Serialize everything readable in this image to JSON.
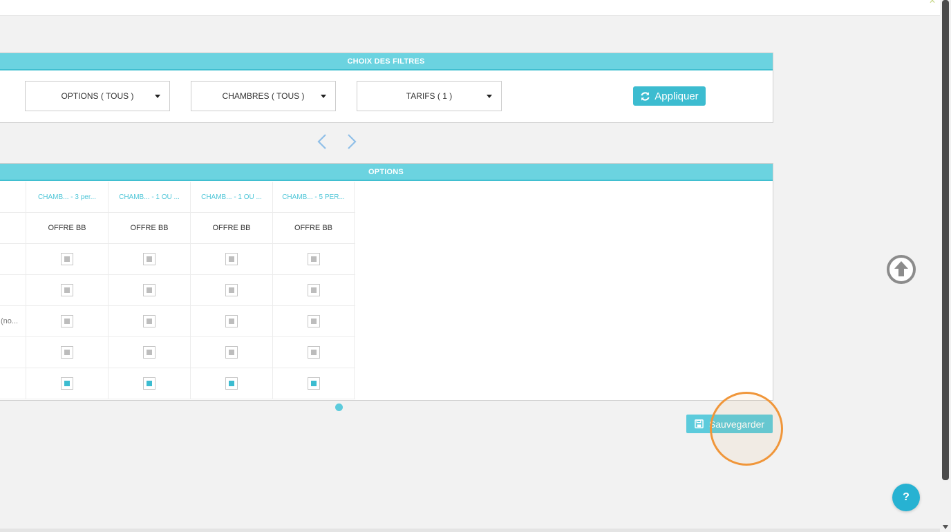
{
  "filters": {
    "title": "CHOIX DES FILTRES",
    "options_label": "OPTIONS ( TOUS )",
    "rooms_label": "CHAMBRES ( TOUS )",
    "rates_label": "TARIFS ( 1 )",
    "apply_label": "Appliquer"
  },
  "options": {
    "title": "OPTIONS",
    "columns": [
      "CHAMB... - 3 per...",
      "CHAMB... - 1 OU ...",
      "CHAMB... - 1 OU ...",
      "CHAMB... - 5 PER..."
    ],
    "offer": "OFFRE BB",
    "row_stub": "(no...",
    "checked_rows": [
      false,
      false,
      false,
      false,
      true
    ]
  },
  "actions": {
    "save_label": "Sauvegarder",
    "help_label": "?"
  },
  "colors": {
    "accent": "#6bd3e0",
    "button": "#3cbcd0",
    "highlight": "#f0963a"
  },
  "icons": {
    "apply": "refresh-icon",
    "save": "floppy-disk-icon",
    "scroll_top": "arrow-up-circle-icon"
  }
}
